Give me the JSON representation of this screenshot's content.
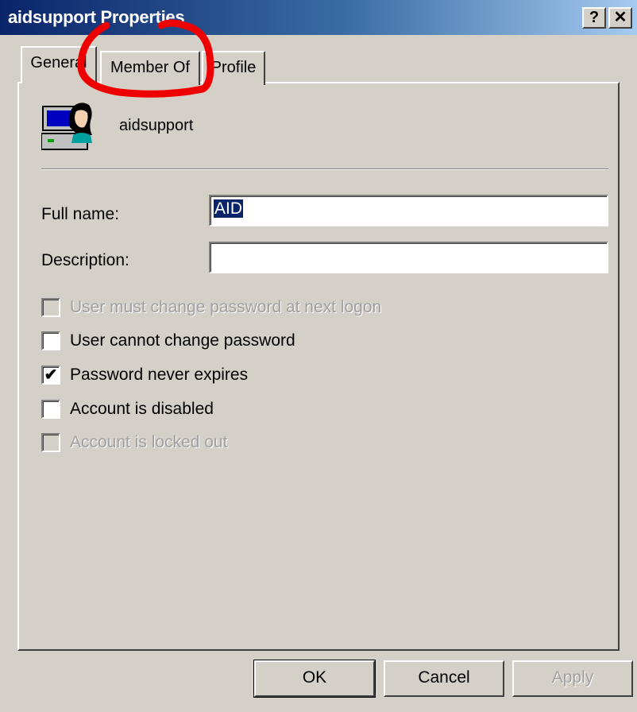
{
  "window": {
    "title": "aidsupport Properties",
    "help_label": "?",
    "close_label": "✕"
  },
  "tabs": [
    {
      "label": "General",
      "selected": true
    },
    {
      "label": "Member Of",
      "selected": false
    },
    {
      "label": "Profile",
      "selected": false
    }
  ],
  "user": {
    "name": "aidsupport",
    "icon": "user-computer-icon"
  },
  "fields": {
    "full_name": {
      "label": "Full name:",
      "value": "AID"
    },
    "description": {
      "label": "Description:",
      "value": ""
    }
  },
  "checkboxes": [
    {
      "label": "User must change password at next logon",
      "checked": false,
      "enabled": false
    },
    {
      "label": "User cannot change password",
      "checked": false,
      "enabled": true
    },
    {
      "label": "Password never expires",
      "checked": true,
      "enabled": true
    },
    {
      "label": "Account is disabled",
      "checked": false,
      "enabled": true
    },
    {
      "label": "Account is locked out",
      "checked": false,
      "enabled": false
    }
  ],
  "buttons": {
    "ok": "OK",
    "cancel": "Cancel",
    "apply": "Apply"
  },
  "colors": {
    "titlebar_start": "#0a246a",
    "titlebar_end": "#a6caf0",
    "face": "#d4d0c8",
    "annotation": "#ee0000"
  }
}
